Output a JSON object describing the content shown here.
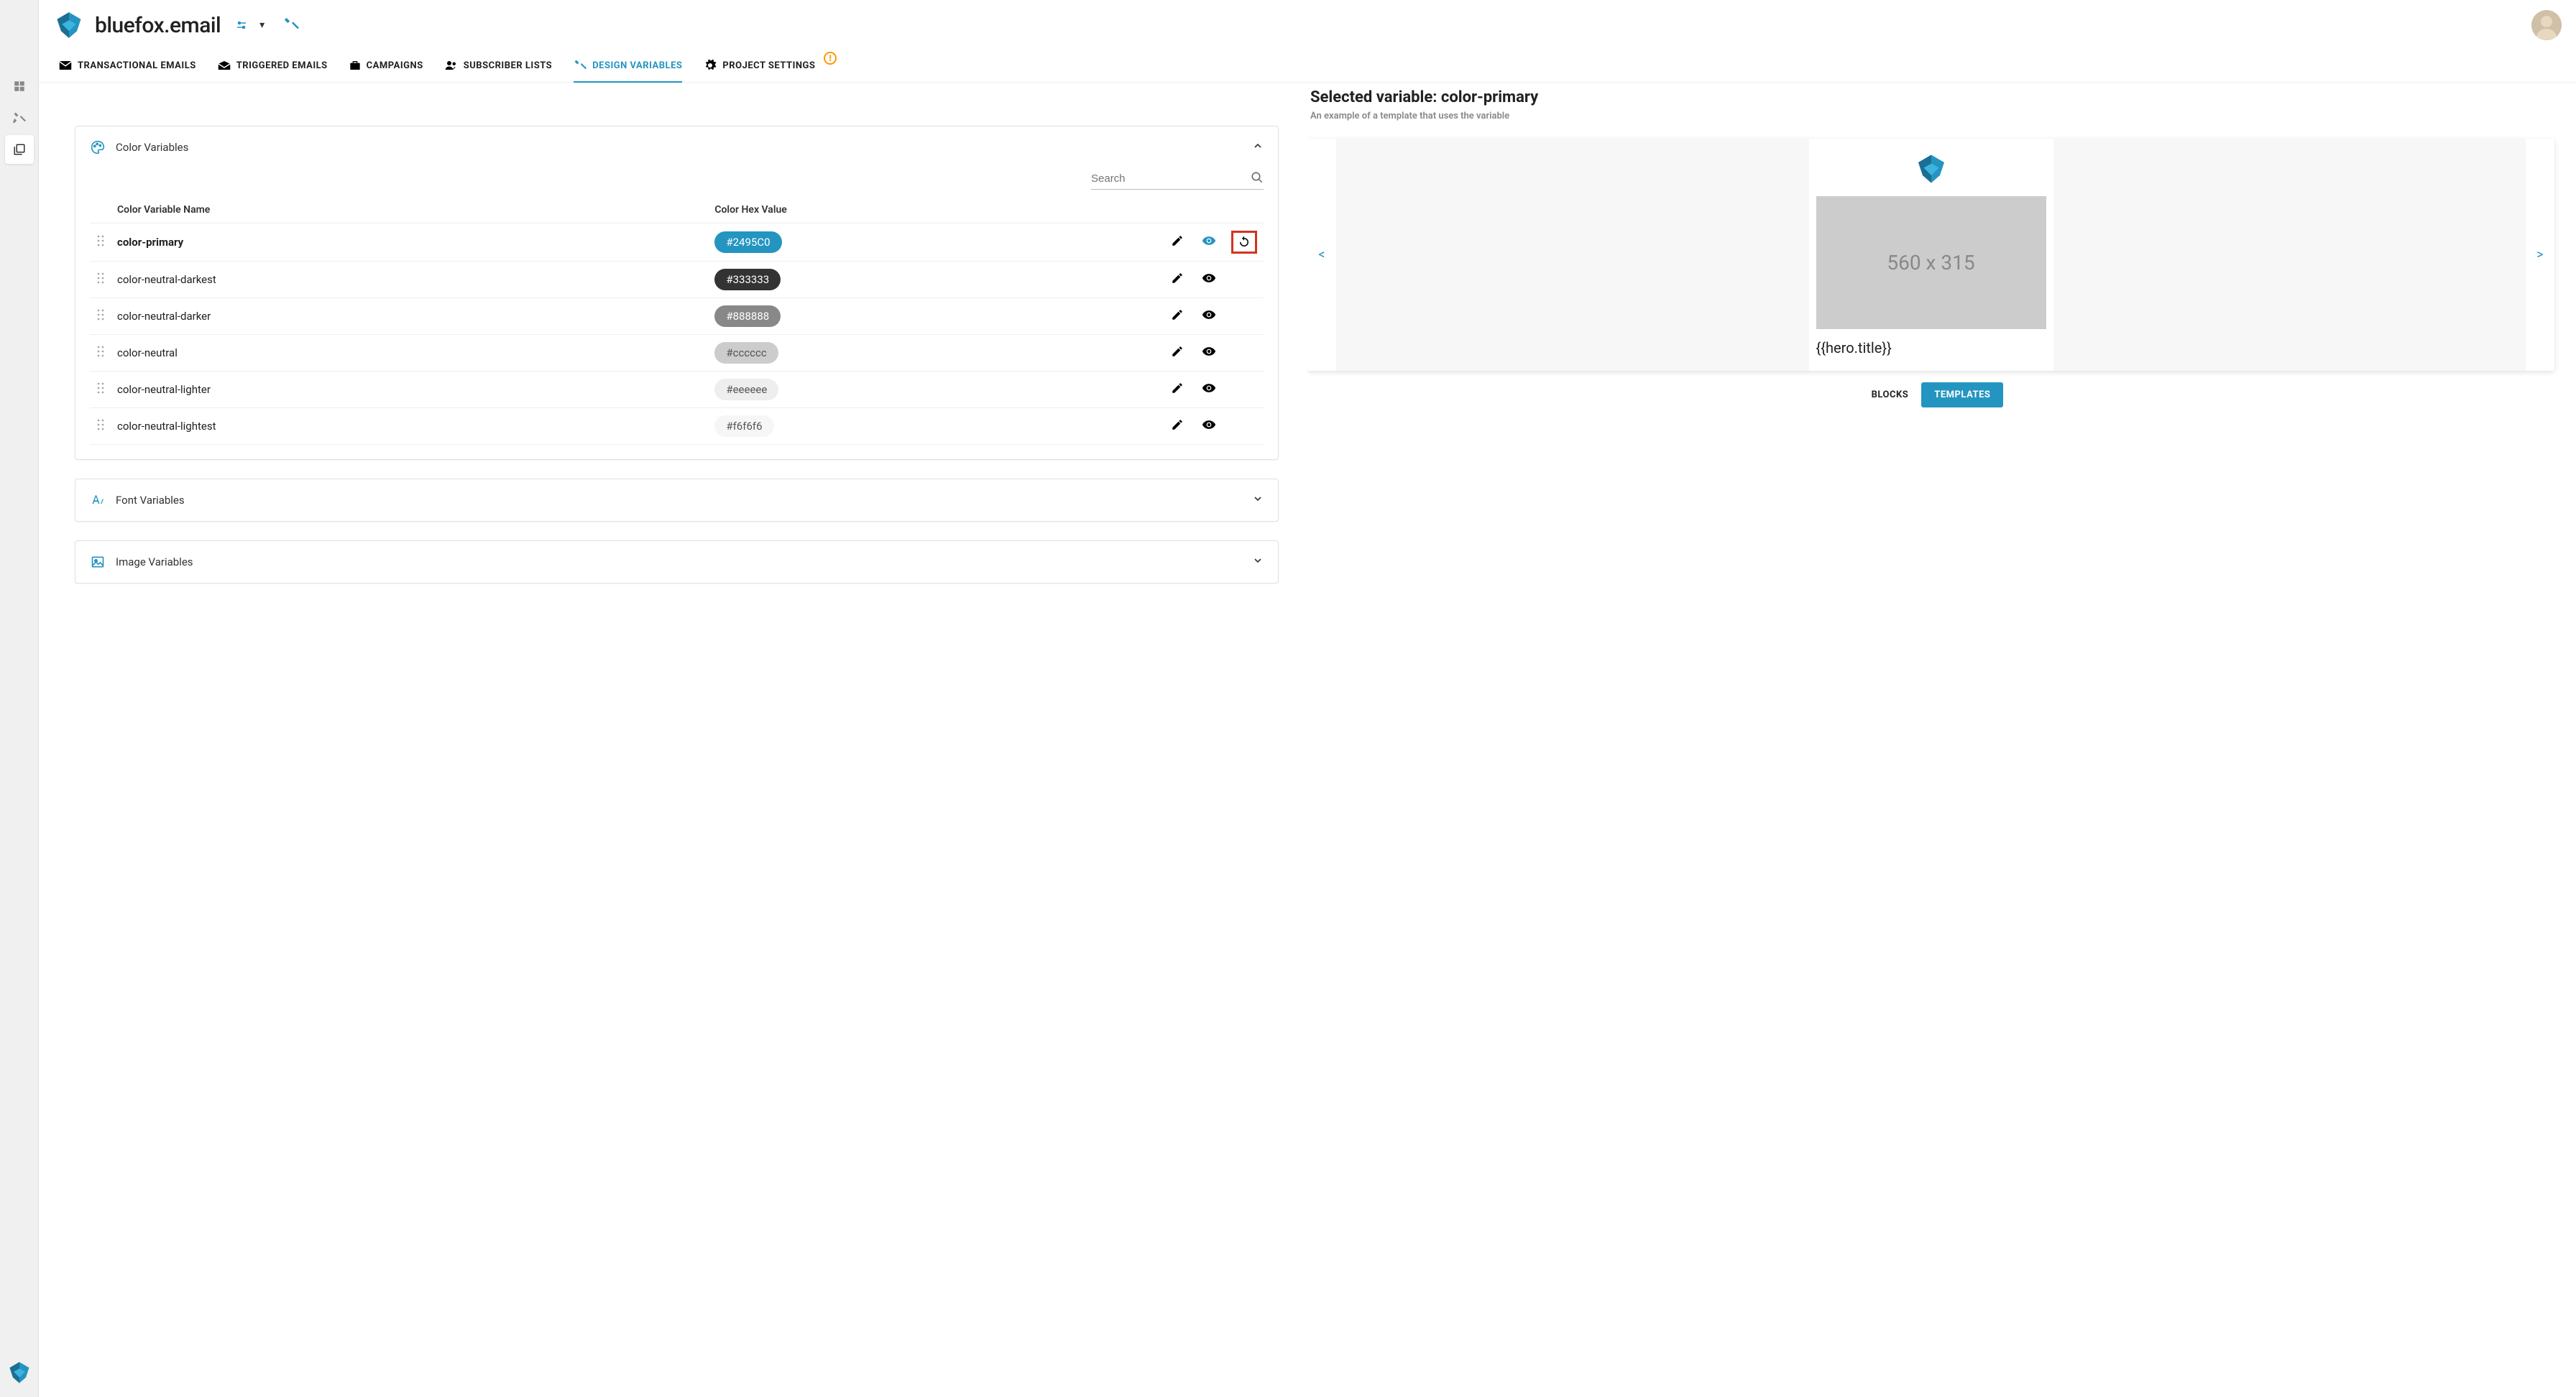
{
  "brand": "bluefox.email",
  "tabs": [
    {
      "label": "TRANSACTIONAL EMAILS",
      "icon": "mail"
    },
    {
      "label": "TRIGGERED EMAILS",
      "icon": "mail-open"
    },
    {
      "label": "CAMPAIGNS",
      "icon": "briefcase"
    },
    {
      "label": "SUBSCRIBER LISTS",
      "icon": "people"
    },
    {
      "label": "DESIGN VARIABLES",
      "icon": "tools",
      "active": true
    },
    {
      "label": "PROJECT SETTINGS",
      "icon": "gear",
      "warn": true
    }
  ],
  "panels": {
    "colors": {
      "title": "Color Variables",
      "open": true,
      "search_placeholder": "Search",
      "columns": {
        "name": "Color Variable Name",
        "hex": "Color Hex Value"
      },
      "rows": [
        {
          "name": "color-primary",
          "hex": "#2495C0",
          "chip_bg": "#2495C0",
          "chip_text": "#ffffff",
          "selected": true
        },
        {
          "name": "color-neutral-darkest",
          "hex": "#333333",
          "chip_bg": "#333333",
          "chip_text": "#ffffff"
        },
        {
          "name": "color-neutral-darker",
          "hex": "#888888",
          "chip_bg": "#888888",
          "chip_text": "#ffffff"
        },
        {
          "name": "color-neutral",
          "hex": "#cccccc",
          "chip_bg": "#cccccc",
          "chip_text": "#555555"
        },
        {
          "name": "color-neutral-lighter",
          "hex": "#eeeeee",
          "chip_bg": "#eeeeee",
          "chip_text": "#555555"
        },
        {
          "name": "color-neutral-lightest",
          "hex": "#f6f6f6",
          "chip_bg": "#f6f6f6",
          "chip_text": "#555555"
        }
      ]
    },
    "fonts": {
      "title": "Font Variables",
      "open": false
    },
    "images": {
      "title": "Image Variables",
      "open": false
    }
  },
  "selected": {
    "title": "Selected variable: color-primary",
    "sub": "An example of a template that uses the variable",
    "hero_label": "560 x 315",
    "hero_heading": "{{hero.title}}"
  },
  "toggle": {
    "blocks": "BLOCKS",
    "templates": "TEMPLATES",
    "active": "templates"
  },
  "colors": {
    "accent": "#2495C0",
    "warn": "#ff9800"
  }
}
